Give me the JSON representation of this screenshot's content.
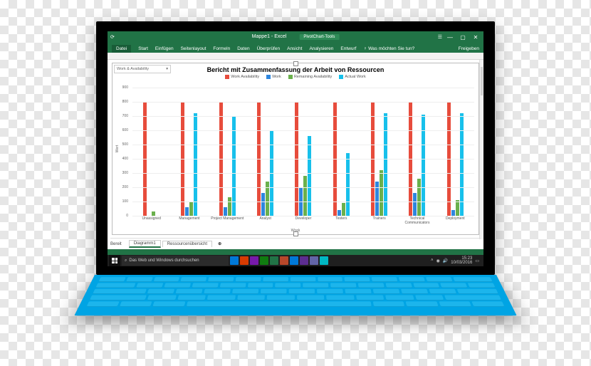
{
  "excel": {
    "doc_title": "Mappe1 - Excel",
    "context_tab": "PivotChart-Tools",
    "file_label": "Datei",
    "tabs": [
      "Start",
      "Einfügen",
      "Seitenlayout",
      "Formeln",
      "Daten",
      "Überprüfen",
      "Ansicht",
      "Analysieren",
      "Entwurf"
    ],
    "tell_me": "Was möchten Sie tun?",
    "share": "Freigeben",
    "sheet_tabs": {
      "active": "Diagramm1",
      "second": "Ressourcenübersicht",
      "status": "Bereit"
    },
    "dropdown": "Work & Availability"
  },
  "chart_data": {
    "type": "bar",
    "title": "Bericht mit Zusammenfassung der Arbeit von Ressourcen",
    "xlabel": "Work",
    "ylabel": "Wert",
    "ylim": [
      0,
      900
    ],
    "yticks": [
      0,
      100,
      200,
      300,
      400,
      500,
      600,
      700,
      800,
      900
    ],
    "series": [
      {
        "name": "Work Availability",
        "color": "#e74c3c"
      },
      {
        "name": "Work",
        "color": "#2e86de"
      },
      {
        "name": "Remaining Availability",
        "color": "#6ab04c"
      },
      {
        "name": "Actual Work",
        "color": "#17c0eb"
      }
    ],
    "categories": [
      "Unassigned",
      "Management",
      "Project Management",
      "Analyst",
      "Developer",
      "Testers",
      "Trainers",
      "Technical Communicators",
      "Deployment"
    ],
    "data": {
      "Unassigned": {
        "red": 800,
        "blue": 0,
        "green": 30,
        "cyan": 0
      },
      "Management": {
        "red": 800,
        "blue": 60,
        "green": 100,
        "cyan": 720
      },
      "Project Management": {
        "red": 800,
        "blue": 60,
        "green": 130,
        "cyan": 700
      },
      "Analyst": {
        "red": 800,
        "blue": 160,
        "green": 240,
        "cyan": 600
      },
      "Developer": {
        "red": 800,
        "blue": 200,
        "green": 280,
        "cyan": 560
      },
      "Testers": {
        "red": 800,
        "blue": 40,
        "green": 90,
        "cyan": 440
      },
      "Trainers": {
        "red": 800,
        "blue": 240,
        "green": 320,
        "cyan": 720
      },
      "Technical Communicators": {
        "red": 800,
        "blue": 160,
        "green": 260,
        "cyan": 710
      },
      "Deployment": {
        "red": 800,
        "blue": 40,
        "green": 110,
        "cyan": 720
      }
    }
  },
  "taskbar": {
    "search_placeholder": "Das Web und Windows durchsuchen",
    "time": "15:23",
    "date": "10/03/2016",
    "app_colors": [
      "#0078d7",
      "#d83b01",
      "#7719aa",
      "#107c10",
      "#217346",
      "#b7472a",
      "#0078d7",
      "#5c2d91",
      "#6264a7",
      "#00b7c3"
    ]
  }
}
